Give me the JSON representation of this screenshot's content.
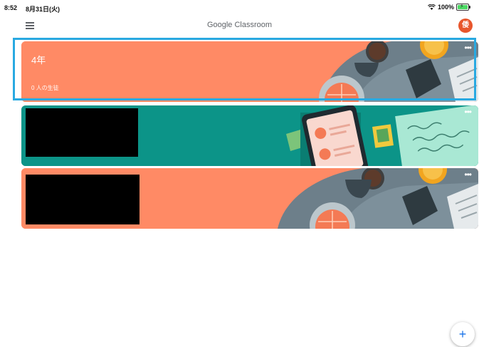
{
  "status_bar": {
    "time": "8:52",
    "date": "8月31日(火)",
    "battery": "100%",
    "battery_level": 1.0
  },
  "app_bar": {
    "title": "Google Classroom",
    "avatar_initial": "倭"
  },
  "classes": [
    {
      "name": "4年",
      "students": "0 人の生徒",
      "more": "•••",
      "theme": "#ff8a65",
      "image": "breakfast"
    },
    {
      "name": "",
      "students": "",
      "more": "•••",
      "theme": "#0c9488",
      "image": "phone-notes",
      "redacted": true
    },
    {
      "name": "",
      "students": "",
      "more": "•••",
      "theme": "#ff8a65",
      "image": "breakfast",
      "redacted": true
    }
  ],
  "fab": {
    "label": "+"
  },
  "colors": {
    "accent": "#29a9e1",
    "avatar": "#e8562c",
    "fab_icon": "#1a73e8"
  }
}
